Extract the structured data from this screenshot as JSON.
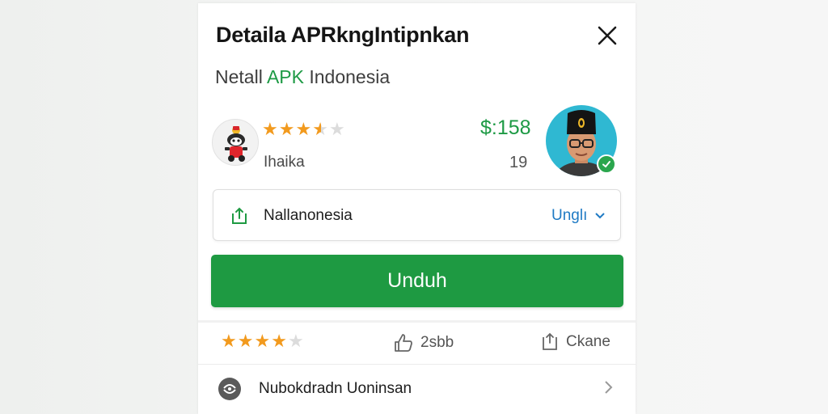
{
  "dialog": {
    "title": "Detaila APRkngIntipnkan",
    "subtitle_prefix": "Netall ",
    "subtitle_accent": "APK",
    "subtitle_suffix": " Indonesia"
  },
  "app": {
    "rating_stars": 3.5,
    "label": "Ihaika",
    "price": "$:158",
    "count": "19"
  },
  "developer_row": {
    "name": "Nallanonesia",
    "link_label": "Unglı"
  },
  "download_button": {
    "label": "Unduh"
  },
  "stats": {
    "rating_stars": 4,
    "likes": "2sbb",
    "share_label": "Ckane"
  },
  "info_row": {
    "label": "Nubokdradn Uoninsan"
  },
  "colors": {
    "accent_green": "#1e9a42",
    "star_orange": "#f29a1e",
    "link_blue": "#1f7ac4",
    "verified_green": "#2aa64d",
    "avatar_bg": "#2fb8d2"
  }
}
